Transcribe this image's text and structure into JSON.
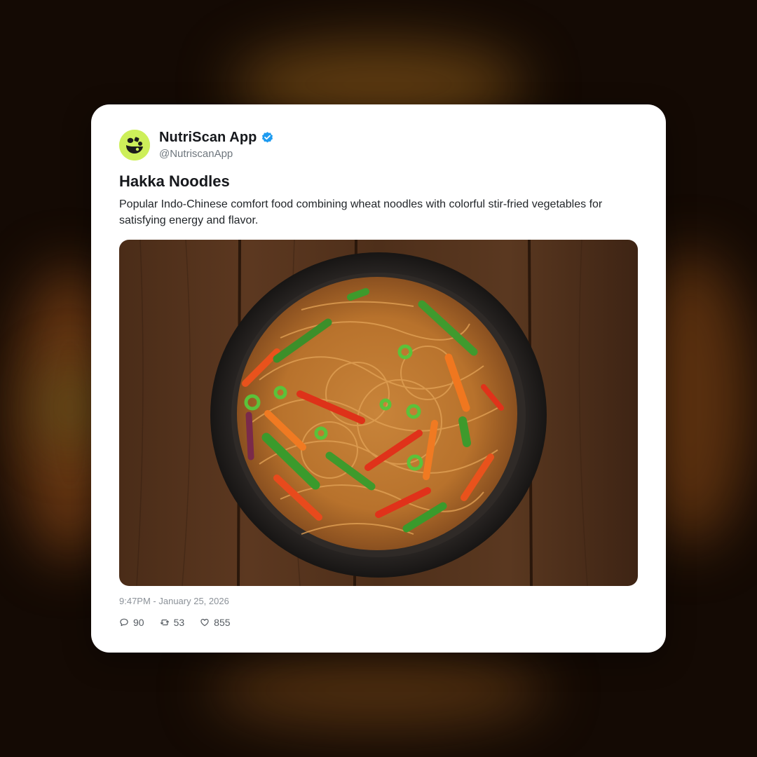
{
  "post": {
    "display_name": "NutriScan App",
    "handle": "@NutriscanApp",
    "verified": true,
    "title": "Hakka Noodles",
    "body": "Popular Indo-Chinese comfort food combining wheat noodles with colorful stir-fried vegetables for satisfying energy and flavor.",
    "timestamp": "9:47PM - January 25, 2026",
    "stats": {
      "replies": "90",
      "reposts": "53",
      "likes": "855"
    }
  },
  "colors": {
    "avatar_bg": "#cdef5a",
    "verified_badge": "#1d9bf0"
  },
  "icons": {
    "reply": "reply-icon",
    "repost": "repost-icon",
    "like": "heart-icon",
    "verified": "verified-badge-icon",
    "logo": "nutriscan-logo-icon"
  }
}
